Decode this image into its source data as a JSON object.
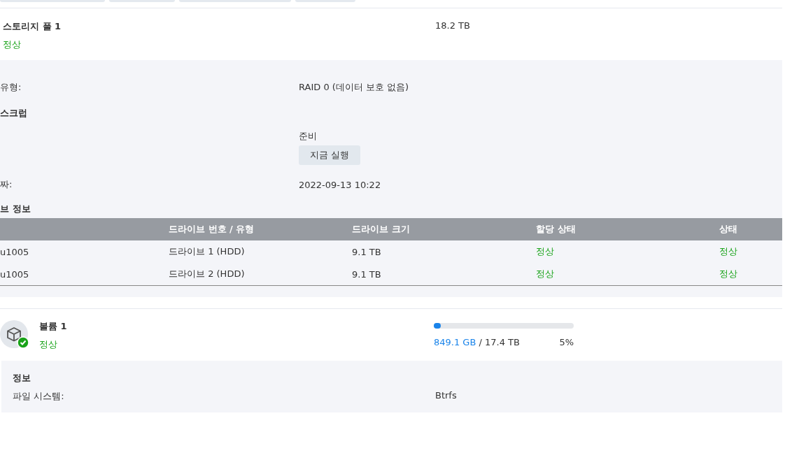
{
  "storage_pool": {
    "name": "스토리지 풀 1",
    "status": "정상",
    "healthy": true,
    "capacity": "18.2 TB"
  },
  "pool_details": [
    {
      "kind": "field",
      "label": "유형:",
      "value": "RAID 0 (데이터 보호 없음)"
    },
    {
      "kind": "heading",
      "label": "스크럽"
    },
    {
      "kind": "status_action",
      "value": "준비",
      "button": "지금 실행"
    },
    {
      "kind": "field",
      "label": "짜:",
      "value": "2022-09-13 10:22"
    },
    {
      "kind": "heading",
      "label": "브 정보"
    }
  ],
  "drive_table": {
    "columns": [
      "",
      "드라이브 번호 / 유형",
      "드라이브 크기",
      "할당 상태",
      "상태"
    ],
    "rows": [
      {
        "cells": [
          "u1005",
          "드라이브 1 (HDD)",
          "9.1 TB"
        ],
        "allocation": "정상",
        "status": "정상"
      },
      {
        "cells": [
          "u1005",
          "드라이브 2 (HDD)",
          "9.1 TB"
        ],
        "allocation": "정상",
        "status": "정상"
      }
    ]
  },
  "volume": {
    "name": "볼륨 1",
    "status": "정상",
    "healthy": true,
    "used": "849.1 GB",
    "total": " / 17.4 TB",
    "percent": "5%",
    "level": 0.05
  },
  "volume_info": {
    "heading": "정보",
    "fields": [
      {
        "label": "파일 시스템:",
        "value": "Btrfs"
      }
    ]
  }
}
